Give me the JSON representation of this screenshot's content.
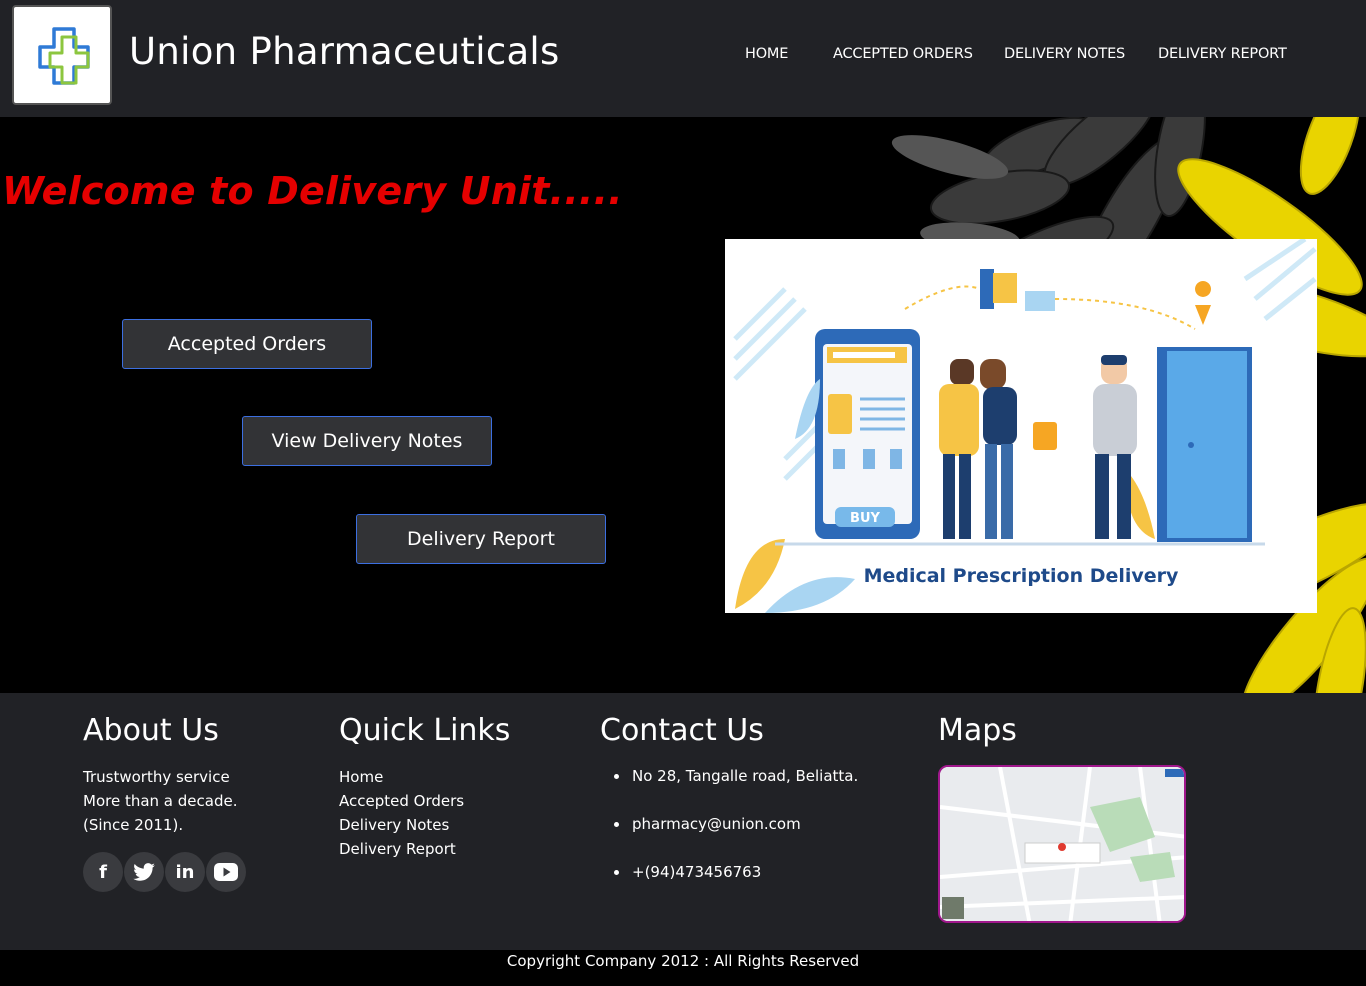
{
  "header": {
    "brand": "Union Pharmaceuticals",
    "nav": [
      "HOME",
      "ACCEPTED ORDERS",
      "DELIVERY NOTES",
      "DELIVERY REPORT"
    ]
  },
  "hero": {
    "welcome": "Welcome to Delivery Unit.....",
    "buttons": [
      "Accepted Orders",
      "View Delivery Notes",
      "Delivery Report"
    ],
    "illustration_caption": "Medical Prescription Delivery",
    "illustration_buy": "BUY"
  },
  "footer": {
    "about": {
      "title": "About Us",
      "lines": [
        "Trustworthy service",
        "More than a decade.",
        "(Since 2011)."
      ]
    },
    "quick_links": {
      "title": "Quick Links",
      "links": [
        "Home",
        "Accepted Orders",
        "Delivery Notes",
        "Delivery Report"
      ]
    },
    "contact": {
      "title": "Contact Us",
      "items": [
        "No 28, Tangalle road, Beliatta.",
        "pharmacy@union.com",
        "+(94)473456763"
      ]
    },
    "maps": {
      "title": "Maps"
    },
    "social_icons": [
      "facebook-icon",
      "twitter-icon",
      "linkedin-icon",
      "youtube-icon"
    ]
  },
  "copyright": "Copyright Company 2012 : All Rights Reserved",
  "colors": {
    "header_bg": "#212226",
    "welcome": "#e50000",
    "button_border": "#3c6fe0",
    "illustration_text": "#1e4a8a"
  }
}
